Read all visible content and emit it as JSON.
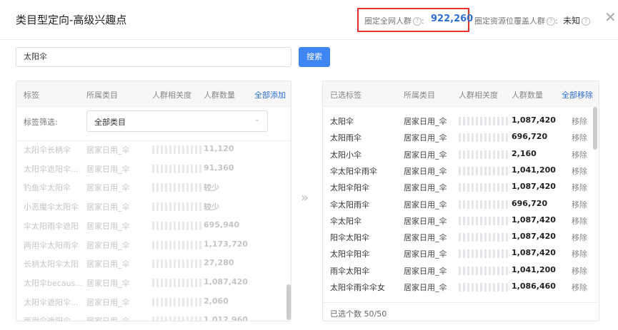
{
  "header": {
    "title": "类目型定向-高级兴趣点",
    "stat1_label": "圈定全网人群",
    "stat1_help": "?",
    "stat1_sep": ":",
    "stat1_value": "922,260",
    "stat2_label": "圈定资源位覆盖人群",
    "stat2_help": "?",
    "stat2_sep": ":",
    "stat2_value": "未知",
    "stat2_help2": "?",
    "close": "✕"
  },
  "search": {
    "value": "太阳伞",
    "button": "搜索"
  },
  "left": {
    "headers": [
      "标签",
      "所属类目",
      "人群相关度",
      "人群数量"
    ],
    "action": "全部添加",
    "filter_label": "标签筛选:",
    "filter_value": "全部类目",
    "rows": [
      {
        "name": "太阳伞长柄伞",
        "cat": "居家日用_伞",
        "count": "11,120"
      },
      {
        "name": "太阳伞遮阳伞...",
        "cat": "居家日用_伞",
        "count": "91,360"
      },
      {
        "name": "钓鱼伞太阳伞",
        "cat": "居家日用_伞",
        "count": "较少"
      },
      {
        "name": "小恶魔伞太阳伞",
        "cat": "居家日用_伞",
        "count": "较少"
      },
      {
        "name": "伞太阳雨伞遮阳",
        "cat": "居家日用_伞",
        "count": "695,940"
      },
      {
        "name": "两用伞太阳雨伞",
        "cat": "居家日用_伞",
        "count": "1,173,720"
      },
      {
        "name": "长柄太阳伞太阳",
        "cat": "居家日用_伞",
        "count": "27,280"
      },
      {
        "name": "太阳伞becaus...",
        "cat": "居家日用_伞",
        "count": "1,087,420"
      },
      {
        "name": "太阳伞遮阳伞...",
        "cat": "居家日用_伞",
        "count": "2,060"
      },
      {
        "name": "两用伞遮阳伞...",
        "cat": "居家日用_伞",
        "count": "1,012,960"
      }
    ]
  },
  "arrow": "»",
  "right": {
    "headers": [
      "已选标签",
      "所属类目",
      "人群相关度",
      "人群数量"
    ],
    "action": "全部移除",
    "remove_label": "移除",
    "rows": [
      {
        "name": "太阳伞",
        "cat": "居家日用_伞",
        "count": "1,087,420"
      },
      {
        "name": "太阳雨伞",
        "cat": "居家日用_伞",
        "count": "696,720"
      },
      {
        "name": "太阳小伞",
        "cat": "居家日用_伞",
        "count": "2,160"
      },
      {
        "name": "伞太阳伞雨伞",
        "cat": "居家日用_伞",
        "count": "1,041,200"
      },
      {
        "name": "太阳伞阳伞",
        "cat": "居家日用_伞",
        "count": "1,087,420"
      },
      {
        "name": "伞太阳雨伞",
        "cat": "居家日用_伞",
        "count": "696,720"
      },
      {
        "name": "伞太阳伞",
        "cat": "居家日用_伞",
        "count": "1,087,420"
      },
      {
        "name": "阳伞太阳伞",
        "cat": "居家日用_伞",
        "count": "1,087,420"
      },
      {
        "name": "太阳伞阳伞",
        "cat": "居家日用_伞",
        "count": "1,087,420"
      },
      {
        "name": "雨伞太阳伞",
        "cat": "居家日用_伞",
        "count": "1,041,200"
      },
      {
        "name": "太阳伞雨伞伞女",
        "cat": "居家日用_伞",
        "count": "1,086,460"
      }
    ],
    "footer": "已选个数 50/50"
  }
}
